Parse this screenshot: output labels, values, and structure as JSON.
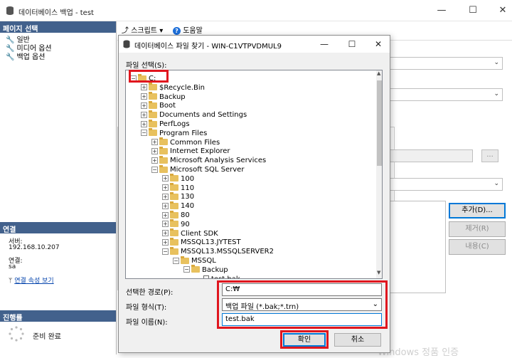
{
  "main_window": {
    "title": "데이터베이스 백업 - test",
    "minimize": "—",
    "maximize": "☐",
    "close": "✕"
  },
  "left_pane": {
    "page_select_header": "페이지 선택",
    "pages": [
      "일반",
      "미디어 옵션",
      "백업 옵션"
    ],
    "connection_header": "연결",
    "server_label": "서버:",
    "server_value": "192.168.10.207",
    "connection_label": "연결:",
    "connection_value": "sa",
    "view_connection_properties": "연결 속성 보기",
    "progress_header": "진행률",
    "progress_status": "준비 완료"
  },
  "toolbar": {
    "script_label": "스크립트",
    "help_label": "도움말"
  },
  "right_buttons": {
    "add": "추가(D)...",
    "remove": "제거(R)",
    "contents": "내용(C)",
    "browse": "..."
  },
  "dialog": {
    "title": "데이터베이스 파일 찾기 - WIN-C1VTPVDMUL9",
    "minimize": "—",
    "maximize": "☐",
    "close": "✕",
    "file_select_label": "파일 선택(S):",
    "tree": [
      {
        "label": "C:",
        "level": 0,
        "expander": "−"
      },
      {
        "label": "$Recycle.Bin",
        "level": 1,
        "expander": "+"
      },
      {
        "label": "Backup",
        "level": 1,
        "expander": "+"
      },
      {
        "label": "Boot",
        "level": 1,
        "expander": "+"
      },
      {
        "label": "Documents and Settings",
        "level": 1,
        "expander": "+"
      },
      {
        "label": "PerfLogs",
        "level": 1,
        "expander": "+"
      },
      {
        "label": "Program Files",
        "level": 1,
        "expander": "−"
      },
      {
        "label": "Common Files",
        "level": 2,
        "expander": "+"
      },
      {
        "label": "Internet Explorer",
        "level": 2,
        "expander": "+"
      },
      {
        "label": "Microsoft Analysis Services",
        "level": 2,
        "expander": "+"
      },
      {
        "label": "Microsoft SQL Server",
        "level": 2,
        "expander": "−"
      },
      {
        "label": "100",
        "level": 3,
        "expander": "+"
      },
      {
        "label": "110",
        "level": 3,
        "expander": "+"
      },
      {
        "label": "130",
        "level": 3,
        "expander": "+"
      },
      {
        "label": "140",
        "level": 3,
        "expander": "+"
      },
      {
        "label": "80",
        "level": 3,
        "expander": "+"
      },
      {
        "label": "90",
        "level": 3,
        "expander": "+"
      },
      {
        "label": "Client SDK",
        "level": 3,
        "expander": "+"
      },
      {
        "label": "MSSQL13.JYTEST",
        "level": 3,
        "expander": "+"
      },
      {
        "label": "MSSQL13.MSSQLSERVER2",
        "level": 3,
        "expander": "−"
      },
      {
        "label": "MSSQL",
        "level": 4,
        "expander": "−"
      },
      {
        "label": "Backup",
        "level": 5,
        "expander": "−"
      },
      {
        "label": "test.bak",
        "level": 6,
        "expander": "",
        "file": true
      }
    ],
    "selected_path_label": "선택한 경로(P):",
    "selected_path_value": "C:₩",
    "file_type_label": "파일 형식(T):",
    "file_type_value": "백업 파일 (*.bak;*.trn)",
    "file_name_label": "파일 이름(N):",
    "file_name_value": "test.bak",
    "ok_button": "확인",
    "cancel_button": "취소"
  },
  "watermark": "Windows 정품 인증",
  "colors": {
    "header_blue": "#42618c",
    "highlight_red": "#e0161e",
    "focus_blue": "#0078d7"
  }
}
